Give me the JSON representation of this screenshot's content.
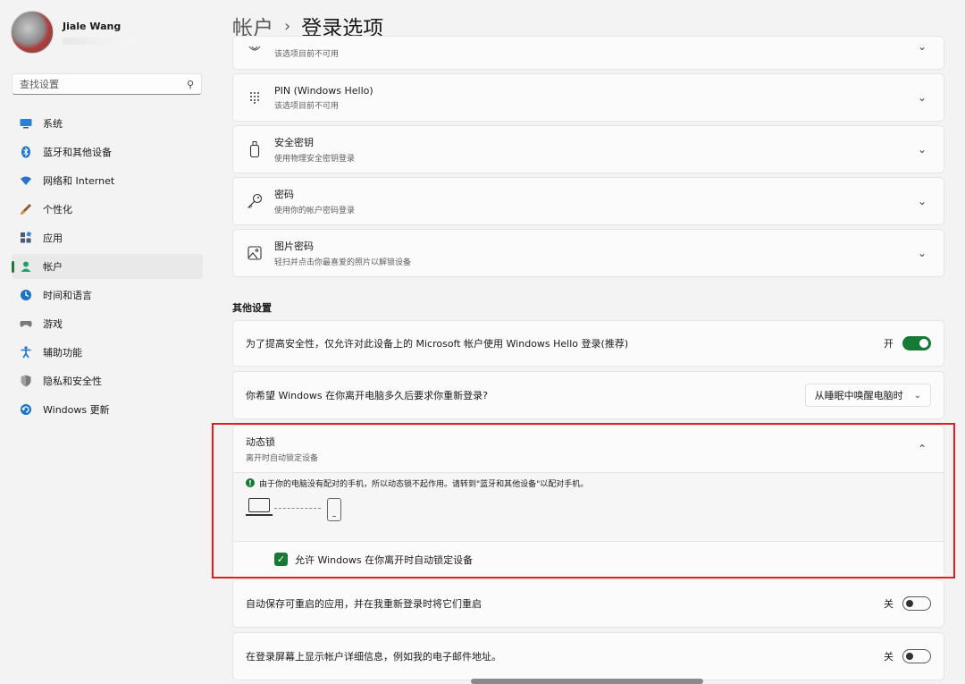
{
  "user": {
    "name": "Jiale Wang"
  },
  "search": {
    "placeholder": "查找设置"
  },
  "sidebar": {
    "items": [
      {
        "label": "系统",
        "icon": "monitor-icon",
        "color": "#1a73c8"
      },
      {
        "label": "蓝牙和其他设备",
        "icon": "bluetooth-icon",
        "color": "#1a73c8"
      },
      {
        "label": "网络和 Internet",
        "icon": "wifi-icon",
        "color": "#2b6fc7"
      },
      {
        "label": "个性化",
        "icon": "brush-icon",
        "color": "#b06a2a"
      },
      {
        "label": "应用",
        "icon": "apps-icon",
        "color": "#4a5a7a"
      },
      {
        "label": "帐户",
        "icon": "person-icon",
        "color": "#1aa06a",
        "active": true
      },
      {
        "label": "时间和语言",
        "icon": "globe-clock-icon",
        "color": "#1a73c8"
      },
      {
        "label": "游戏",
        "icon": "gamepad-icon",
        "color": "#6a6a6a"
      },
      {
        "label": "辅助功能",
        "icon": "accessibility-icon",
        "color": "#1a73c8"
      },
      {
        "label": "隐私和安全性",
        "icon": "shield-icon",
        "color": "#6a6a6a"
      },
      {
        "label": "Windows 更新",
        "icon": "update-icon",
        "color": "#1a73c8"
      }
    ]
  },
  "header": {
    "parent": "帐户",
    "separator": "›",
    "title": "登录选项"
  },
  "signin_options": [
    {
      "title": "",
      "subtitle": "该选项目前不可用",
      "icon": "fingerprint-icon"
    },
    {
      "title": "PIN (Windows Hello)",
      "subtitle": "该选项目前不可用",
      "icon": "pin-pad-icon"
    },
    {
      "title": "安全密钥",
      "subtitle": "使用物理安全密钥登录",
      "icon": "usb-key-icon"
    },
    {
      "title": "密码",
      "subtitle": "使用你的帐户密码登录",
      "icon": "key-icon"
    },
    {
      "title": "图片密码",
      "subtitle": "轻扫并点击你最喜爱的照片以解锁设备",
      "icon": "picture-icon"
    }
  ],
  "other_settings": {
    "title": "其他设置",
    "windows_hello_only": {
      "label": "为了提高安全性，仅允许对此设备上的 Microsoft 帐户使用 Windows Hello 登录(推荐)",
      "state_label": "开",
      "on": true
    },
    "require_signin": {
      "label": "你希望 Windows 在你离开电脑多久后要求你重新登录?",
      "value": "从睡眠中唤醒电脑时"
    },
    "dynamic_lock": {
      "title": "动态锁",
      "subtitle": "离开时自动锁定设备",
      "info": "由于你的电脑没有配对的手机，所以动态锁不起作用。请转到\"蓝牙和其他设备\"以配对手机。",
      "checkbox_label": "允许 Windows 在你离开时自动锁定设备",
      "checked": true
    },
    "restart_apps": {
      "label": "自动保存可重启的应用，并在我重新登录时将它们重启",
      "state_label": "关",
      "on": false
    },
    "show_account_details": {
      "label": "在登录屏幕上显示帐户详细信息，例如我的电子邮件地址。",
      "state_label": "关",
      "on": false
    }
  },
  "colors": {
    "accent": "#167a36",
    "highlight_box": "#e02020"
  }
}
